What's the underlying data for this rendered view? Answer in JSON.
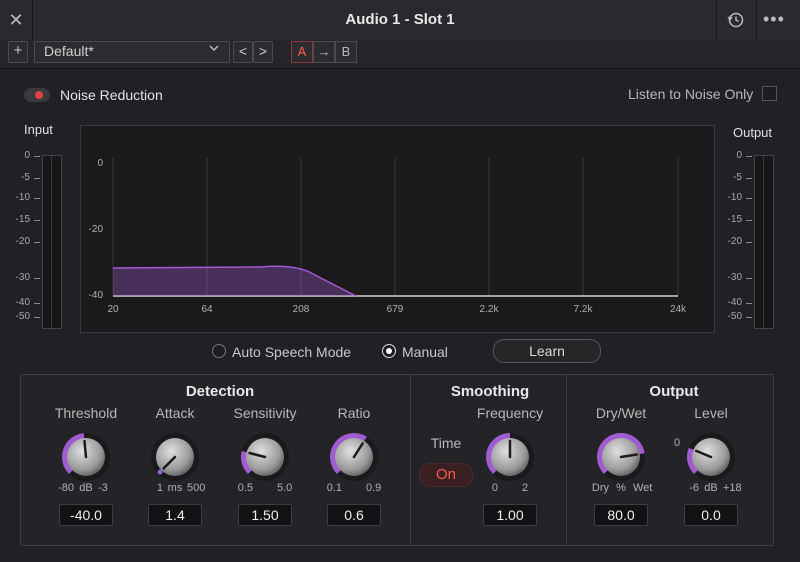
{
  "window": {
    "title": "Audio 1 - Slot 1"
  },
  "toolbar": {
    "add_label": "+",
    "preset_value": "Default*",
    "prev_label": "<",
    "next_label": ">",
    "a_label": "A",
    "copy_label": "→",
    "b_label": "B"
  },
  "header": {
    "noise_reduction_label": "Noise Reduction",
    "noise_reduction_on": true,
    "listen_label": "Listen to Noise Only",
    "listen_checked": false
  },
  "input_meter": {
    "title": "Input",
    "ticks": [
      "0",
      "-5",
      "-10",
      "-15",
      "-20",
      "-30",
      "-40",
      "-50"
    ]
  },
  "output_meter": {
    "title": "Output",
    "ticks": [
      "0",
      "-5",
      "-10",
      "-15",
      "-20",
      "-30",
      "-40",
      "-50"
    ]
  },
  "graph": {
    "y_ticks": [
      "0",
      "-20",
      "-40"
    ],
    "x_ticks": [
      "20",
      "64",
      "208",
      "679",
      "2.2k",
      "7.2k",
      "24k"
    ],
    "curve_color": "#a05cd0"
  },
  "mode": {
    "auto_label": "Auto Speech Mode",
    "manual_label": "Manual",
    "selected": "Manual",
    "learn_label": "Learn"
  },
  "detection": {
    "title": "Detection",
    "threshold": {
      "label": "Threshold",
      "min": "-80",
      "unit": "dB",
      "max": "-3",
      "value": "-40.0",
      "level": 0.48
    },
    "attack": {
      "label": "Attack",
      "min": "1",
      "unit": "ms",
      "max": "500",
      "value": "1.4",
      "level": 0.0
    },
    "sensitivity": {
      "label": "Sensitivity",
      "min": "0.5",
      "max": "5.0",
      "value": "1.50",
      "level": 0.22
    },
    "ratio": {
      "label": "Ratio",
      "min": "0.1",
      "max": "0.9",
      "value": "0.6",
      "level": 0.62
    }
  },
  "smoothing": {
    "title": "Smoothing",
    "time_label": "Time",
    "time_state": "On",
    "frequency": {
      "label": "Frequency",
      "min": "0",
      "max": "2",
      "value": "1.00",
      "level": 0.5
    }
  },
  "output": {
    "title": "Output",
    "drywet": {
      "label": "Dry/Wet",
      "min": "Dry",
      "unit": "%",
      "max": "Wet",
      "value": "80.0",
      "level": 0.8
    },
    "level": {
      "label": "Level",
      "zero_label": "0",
      "min": "-6",
      "unit": "dB",
      "max": "+18",
      "value": "0.0",
      "level": 0.25
    }
  },
  "colors": {
    "accent": "#a05cd0",
    "record": "#e34040",
    "on_text": "#ff5a4a"
  }
}
